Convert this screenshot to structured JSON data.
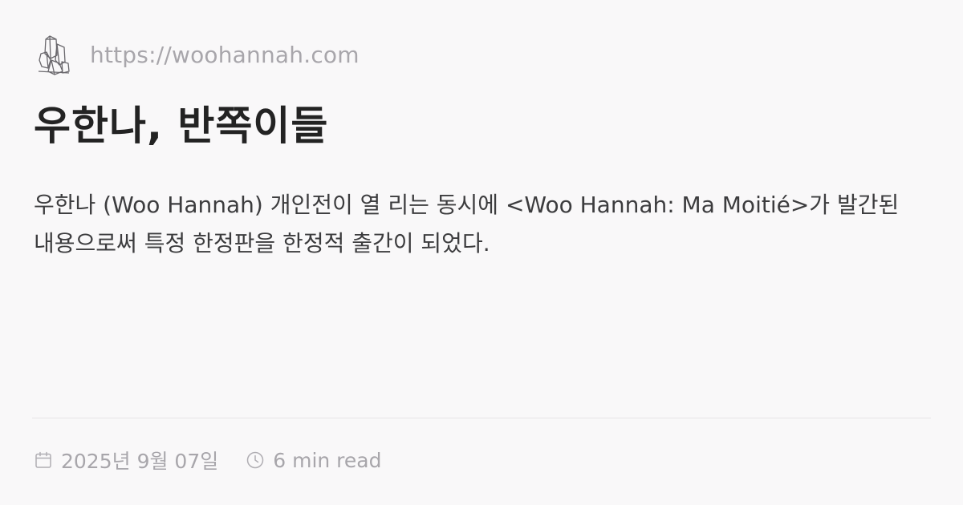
{
  "site": {
    "url": "https://woohannah.com",
    "logo_icon": "crystal-cluster-icon"
  },
  "article": {
    "title": "우한나, 반쪽이들",
    "description": "우한나 (Woo Hannah) 개인전이 열 리는 동시에 <Woo Hannah: Ma Moitié>가 발간된 내용으로써 특정 한정판을 한정적 출간이 되었다."
  },
  "meta": {
    "date": "2025년 9월 07일",
    "date_icon": "calendar-icon",
    "read_time": "6 min read",
    "read_time_icon": "clock-icon"
  },
  "colors": {
    "background": "#f9f8f9",
    "title": "#232323",
    "body": "#3c3c3e",
    "muted": "#a8a6ab",
    "divider": "#e6e4e6"
  }
}
